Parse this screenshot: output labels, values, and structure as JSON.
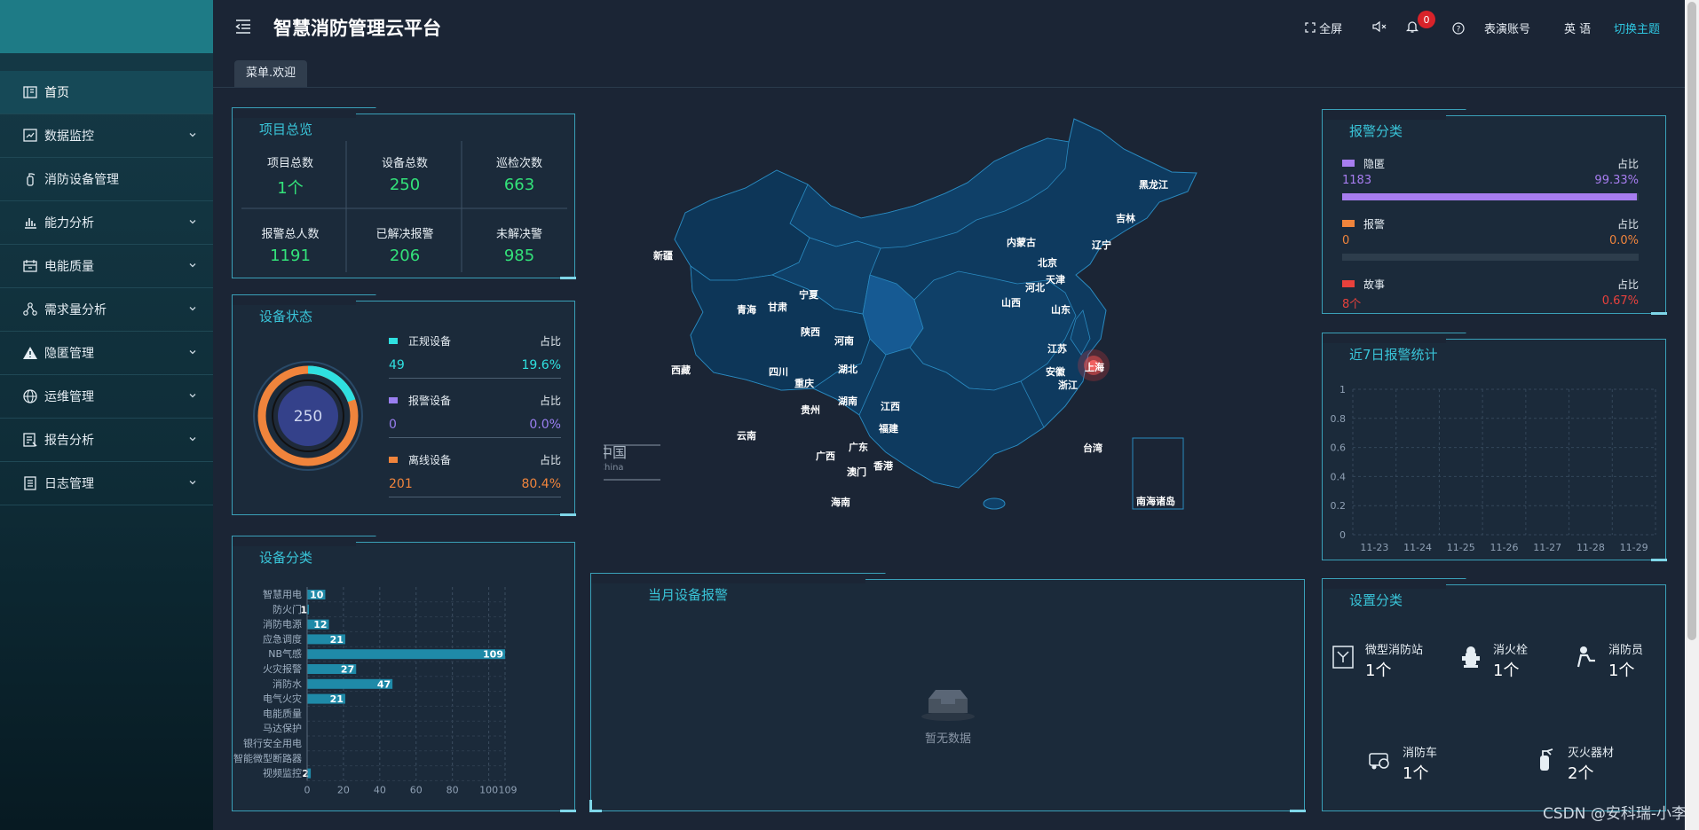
{
  "header": {
    "title": "智慧消防管理云平台",
    "fullscreen": "全屏",
    "notif_count": "0",
    "account": "表演账号",
    "language": "英 语",
    "theme": "切换主题"
  },
  "tabs": [
    {
      "label": "菜单.欢迎"
    }
  ],
  "sidebar": {
    "items": [
      {
        "label": "首页",
        "icon": "home-icon"
      },
      {
        "label": "数据监控",
        "icon": "monitor-icon"
      },
      {
        "label": "消防设备管理",
        "icon": "extinguisher-icon"
      },
      {
        "label": "能力分析",
        "icon": "bar-chart-icon"
      },
      {
        "label": "电能质量",
        "icon": "calendar-icon"
      },
      {
        "label": "需求量分析",
        "icon": "network-icon"
      },
      {
        "label": "隐匿管理",
        "icon": "warning-icon"
      },
      {
        "label": "运维管理",
        "icon": "globe-icon"
      },
      {
        "label": "报告分析",
        "icon": "report-icon"
      },
      {
        "label": "日志管理",
        "icon": "log-icon"
      }
    ]
  },
  "overview": {
    "title": "项目总览",
    "items": [
      {
        "label": "项目总数",
        "value": "1个"
      },
      {
        "label": "设备总数",
        "value": "250"
      },
      {
        "label": "巡检次数",
        "value": "663"
      },
      {
        "label": "报警总人数",
        "value": "1191"
      },
      {
        "label": "已解决报警",
        "value": "206"
      },
      {
        "label": "未解决警",
        "value": "985"
      }
    ]
  },
  "device_status": {
    "title": "设备状态",
    "total": "250",
    "ratio_label": "占比",
    "items": [
      {
        "name": "正规设备",
        "count": "49",
        "pct": "19.6%",
        "color": "#2fe0e0",
        "share": 0.196
      },
      {
        "name": "报警设备",
        "count": "0",
        "pct": "0.0%",
        "color": "#9a7ff0",
        "share": 0
      },
      {
        "name": "离线设备",
        "count": "201",
        "pct": "80.4%",
        "color": "#f0843c",
        "share": 0.804
      }
    ]
  },
  "device_class": {
    "title": "设备分类"
  },
  "map": {
    "title": "中国",
    "subtitle": "China",
    "inset_label": "南海诸岛",
    "provinces": [
      "黑龙江",
      "吉林",
      "辽宁",
      "内蒙古",
      "北京",
      "天津",
      "河北",
      "山西",
      "山东",
      "新疆",
      "青海",
      "甘肃",
      "宁夏",
      "陕西",
      "河南",
      "江苏",
      "安徽",
      "上海",
      "浙江",
      "湖北",
      "四川",
      "重庆",
      "西藏",
      "贵州",
      "湖南",
      "江西",
      "福建",
      "台湾",
      "云南",
      "广西",
      "广东",
      "澳门",
      "香港",
      "海南"
    ]
  },
  "monthly_alarm": {
    "title": "当月设备报警",
    "empty_text": "暂无数据"
  },
  "alarm_class": {
    "title": "报警分类",
    "ratio_label": "占比",
    "items": [
      {
        "name": "隐匿",
        "count": "1183",
        "pct": "99.33%",
        "color": "#a77df0",
        "share": 0.9933
      },
      {
        "name": "报警",
        "count": "0",
        "pct": "0.0%",
        "color": "#f0843c",
        "share": 0
      },
      {
        "name": "故事",
        "count": "8个",
        "pct": "0.67%",
        "color": "#e8413c",
        "share": 0.0067
      }
    ]
  },
  "weekly_alarm": {
    "title": "近7日报警统计"
  },
  "settings": {
    "title": "设置分类",
    "items": [
      {
        "name": "微型消防站",
        "value": "1个",
        "icon": "mini-station-icon"
      },
      {
        "name": "消火栓",
        "value": "1个",
        "icon": "hydrant-icon"
      },
      {
        "name": "消防员",
        "value": "1个",
        "icon": "firefighter-icon"
      },
      {
        "name": "消防车",
        "value": "1个",
        "icon": "fire-truck-icon"
      },
      {
        "name": "灭火器材",
        "value": "2个",
        "icon": "extinguisher-icon"
      }
    ]
  },
  "watermark": "CSDN @安科瑞-小李",
  "chart_data": [
    {
      "type": "bar",
      "orientation": "horizontal",
      "title": "设备分类",
      "categories": [
        "智慧用电",
        "防火门",
        "消防电源",
        "应急调度",
        "NB气感",
        "火灾报警",
        "消防水",
        "电气火灾",
        "电能质量",
        "马达保护",
        "银行安全用电",
        "智能微型断路器",
        "视频监控"
      ],
      "values": [
        10,
        1,
        12,
        21,
        109,
        27,
        47,
        21,
        0,
        0,
        0,
        0,
        2
      ],
      "xlim": [
        0,
        109
      ],
      "xticks": [
        "0",
        "20",
        "40",
        "60",
        "80",
        "100",
        "109"
      ],
      "color": "#1f8aa8",
      "grid": true
    },
    {
      "type": "line",
      "title": "近7日报警统计",
      "categories": [
        "11-23",
        "11-24",
        "11-25",
        "11-26",
        "11-27",
        "11-28",
        "11-29"
      ],
      "values": [],
      "ylim": [
        0,
        1
      ],
      "yticks": [
        "0",
        "0.2",
        "0.4",
        "0.6",
        "0.8",
        "1"
      ],
      "grid": true
    }
  ]
}
